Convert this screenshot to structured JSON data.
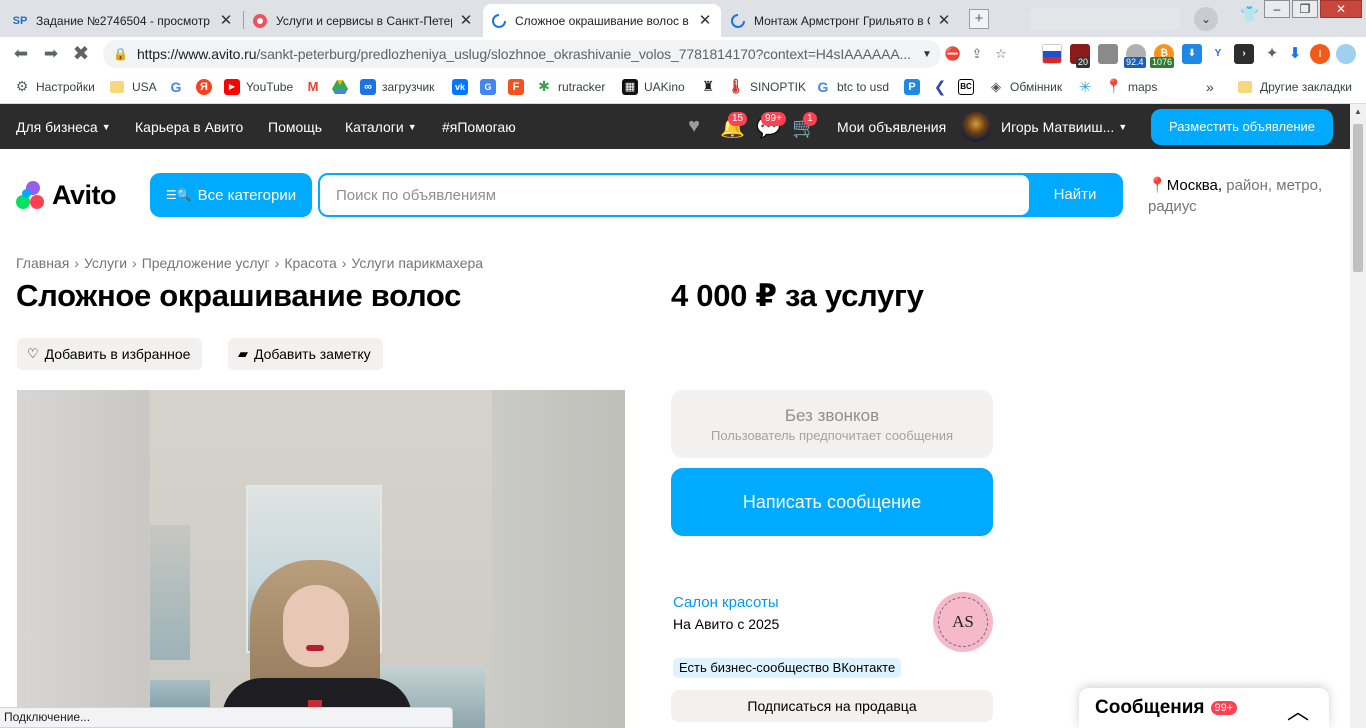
{
  "browser": {
    "tabs": [
      {
        "icon": "sp-favicon",
        "icon_text": "SP",
        "title": "Задание №2746504 - просмотр з",
        "active": false
      },
      {
        "icon": "red-circle-favicon",
        "icon_text": "",
        "title": "Услуги и сервисы в Санкт-Петерб",
        "active": false
      },
      {
        "icon": "loading-spinner-icon",
        "icon_text": "",
        "title": "Сложное окрашивание волос в С",
        "active": true
      },
      {
        "icon": "loading-spinner-icon",
        "icon_text": "",
        "title": "Монтаж Армстронг Грильято в Са",
        "active": false
      }
    ],
    "url_domain": "https://www.avito.ru",
    "url_path": "/sankt-peterburg/predlozheniya_uslug/slozhnoe_okrashivanie_volos_7781814170?context=H4sIAAAAAA...",
    "ext_badges": {
      "ext1": "20",
      "ext2": "92.4",
      "ext3": "1076"
    },
    "profile_initial": "I",
    "bookmarks": [
      {
        "label": "Настройки",
        "icon": "gear-icon"
      },
      {
        "label": "USA",
        "icon": "folder-icon"
      },
      {
        "label": "",
        "icon": "google-icon"
      },
      {
        "label": "",
        "icon": "yandex-icon"
      },
      {
        "label": "YouTube",
        "icon": "youtube-icon"
      },
      {
        "label": "",
        "icon": "gmail-icon"
      },
      {
        "label": "",
        "icon": "drive-icon"
      },
      {
        "label": "загрузчик",
        "icon": "infinity-icon"
      },
      {
        "label": "",
        "icon": "vk-icon"
      },
      {
        "label": "",
        "icon": "translate-icon"
      },
      {
        "label": "",
        "icon": "f-icon"
      },
      {
        "label": "rutracker",
        "icon": "rutracker-icon"
      },
      {
        "label": "UAKino",
        "icon": "uakino-icon"
      },
      {
        "label": "",
        "icon": "bottle-icon"
      },
      {
        "label": "SINOPTIK",
        "icon": "thermometer-icon"
      },
      {
        "label": "btc to usd",
        "icon": "google-icon"
      },
      {
        "label": "",
        "icon": "p-icon"
      },
      {
        "label": "",
        "icon": "arrow-icon"
      },
      {
        "label": "",
        "icon": "bc-icon"
      },
      {
        "label": "Обмінник",
        "icon": "exchange-icon"
      },
      {
        "label": "",
        "icon": "spark-icon"
      },
      {
        "label": "maps",
        "icon": "maps-icon"
      }
    ],
    "more_bookmarks": "»",
    "other_bookmarks": "Другие закладки",
    "status_text": "Подключение..."
  },
  "avito": {
    "nav": {
      "business": "Для бизнеса",
      "career": "Карьера в Авито",
      "help": "Помощь",
      "catalogs": "Каталоги",
      "help_tag": "#яПомогаю"
    },
    "badges": {
      "notifications": "15",
      "messages": "99+",
      "cart": "1"
    },
    "my_ads": "Мои объявления",
    "user_name": "Игорь Матвииш...",
    "post_ad": "Разместить объявление",
    "logo_text": "Avito",
    "all_categories": "Все категории",
    "search_placeholder": "Поиск по объявлениям",
    "search_button": "Найти",
    "location_city": "Москва,",
    "location_rest": " район, метро, радиус"
  },
  "listing": {
    "breadcrumbs": [
      "Главная",
      "Услуги",
      "Предложение услуг",
      "Красота",
      "Услуги парикмахера"
    ],
    "title": "Сложное окрашивание волос",
    "price": "4 000 ₽ за услугу",
    "add_favorite": "Добавить в избранное",
    "add_note": "Добавить заметку",
    "no_calls_title": "Без звонков",
    "no_calls_subtitle": "Пользователь предпочитает сообщения",
    "write_message": "Написать сообщение",
    "seller_type": "Салон красоты",
    "seller_since": "На Авито с 2025",
    "seller_logo_text": "AS",
    "vk_badge": "Есть бизнес-сообщество ВКонтакте",
    "subscribe": "Подписаться на продавца"
  },
  "messenger": {
    "title": "Сообщения",
    "badge": "99+"
  },
  "colors": {
    "accent": "#00aaff",
    "header_bg": "#2c2c2c",
    "badge": "#ff4053",
    "link": "#0099f7"
  }
}
